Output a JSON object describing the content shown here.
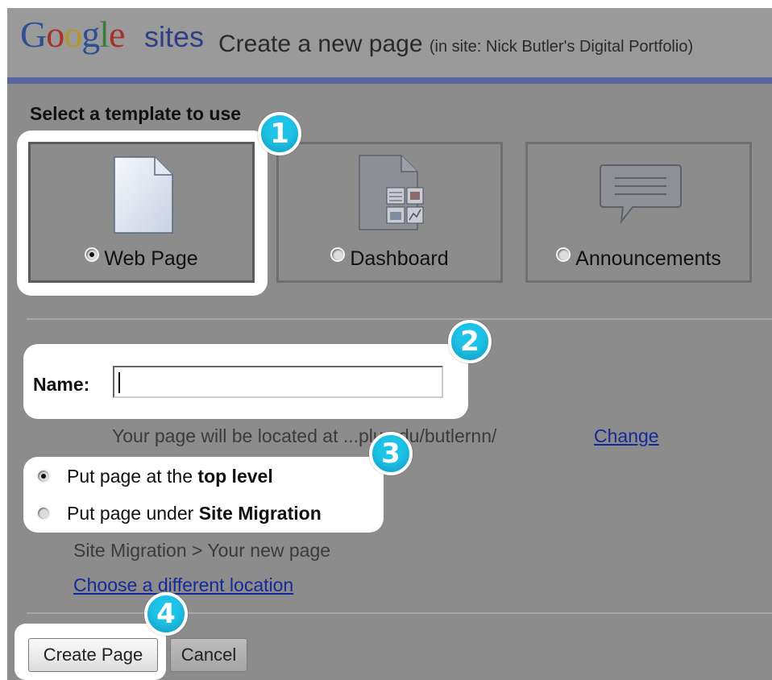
{
  "header": {
    "logo_word": "Google",
    "logo_sites": "sites",
    "title": "Create a new page",
    "site_note": "(in site: Nick Butler's Digital Portfolio)"
  },
  "template": {
    "label": "Select a template to use",
    "options": [
      {
        "label": "Web Page",
        "selected": true,
        "icon": "blank-page-icon"
      },
      {
        "label": "Dashboard",
        "selected": false,
        "icon": "dashboard-icon"
      },
      {
        "label": "Announcements",
        "selected": false,
        "icon": "speech-bubble-icon"
      }
    ]
  },
  "name": {
    "label": "Name:",
    "value": "",
    "placeholder": ""
  },
  "location": {
    "url_text": "Your page will be located at ...plu.edu/butlernn/",
    "change_label": "Change",
    "top_level": {
      "prefix": "Put page at the ",
      "bold": "top level",
      "selected": true
    },
    "under": {
      "prefix": "Put page under ",
      "bold": "Site Migration",
      "selected": false
    },
    "breadcrumb": "Site Migration > Your new page",
    "choose_label": "Choose a different location"
  },
  "buttons": {
    "create_label": "Create Page",
    "cancel_label": "Cancel"
  },
  "callouts": [
    "1",
    "2",
    "3",
    "4"
  ],
  "colors": {
    "overlay": "#8c8c8c",
    "header_bar": "#5765a0",
    "callout": "#1ec4e8",
    "link": "#152a9a"
  }
}
